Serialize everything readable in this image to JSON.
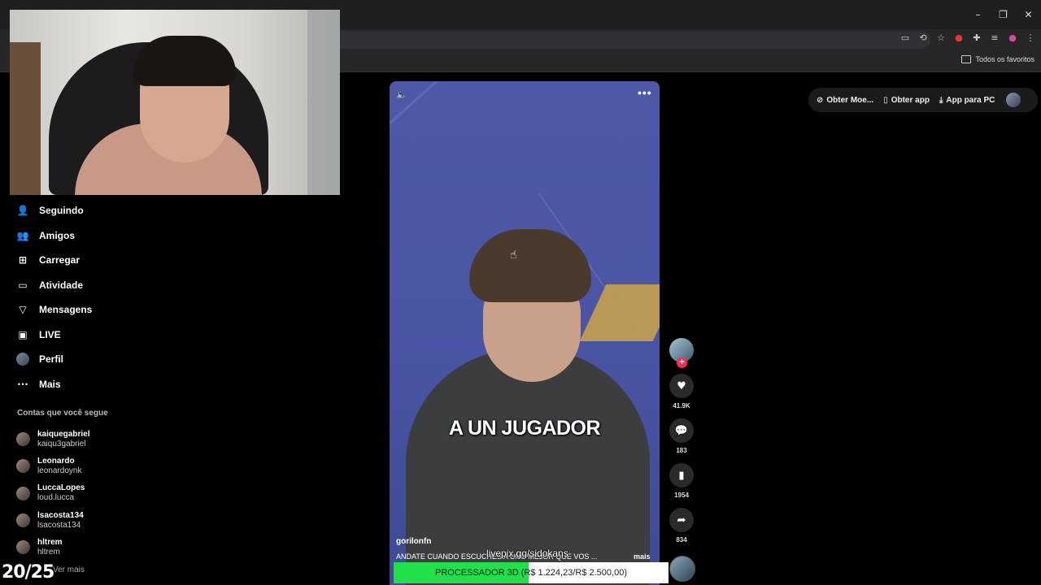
{
  "browser": {
    "window_controls": [
      "–",
      "❐",
      "✕"
    ],
    "bookmarks_all": "Todos os favoritos",
    "toolbar_icons": [
      "cast-icon",
      "translate-icon",
      "star-icon",
      "extension-red-icon",
      "puzzle-icon",
      "media-icon",
      "profile-icon",
      "menu-icon"
    ]
  },
  "sidebar": {
    "items": [
      {
        "label": "Seguindo",
        "icon": "following-icon",
        "glyph": "👤"
      },
      {
        "label": "Amigos",
        "icon": "friends-icon",
        "glyph": "👥"
      },
      {
        "label": "Carregar",
        "icon": "upload-icon",
        "glyph": "⊞"
      },
      {
        "label": "Atividade",
        "icon": "activity-icon",
        "glyph": "▭"
      },
      {
        "label": "Mensagens",
        "icon": "messages-icon",
        "glyph": "▽"
      },
      {
        "label": "LIVE",
        "icon": "live-icon",
        "glyph": "▣"
      },
      {
        "label": "Perfil",
        "icon": "profile-avatar",
        "glyph": ""
      },
      {
        "label": "Mais",
        "icon": "more-icon",
        "glyph": "···"
      }
    ],
    "following_heading": "Contas que você segue",
    "following": [
      {
        "name": "kaiquegabriel",
        "user": "kaiqu3gabriel"
      },
      {
        "name": "Leonardo",
        "user": "leonardoynk"
      },
      {
        "name": "LuccaLopes",
        "user": "loud.lucca"
      },
      {
        "name": "lsacosta134",
        "user": "lsacosta134"
      },
      {
        "name": "hltrem",
        "user": "hltrem"
      }
    ],
    "see_more": "Ver mais"
  },
  "overlay": {
    "score": "20/25",
    "livepix": "livepix.gg/sidokans"
  },
  "video": {
    "caption_overlay": "A UN JUGADOR",
    "author": "gorilonfn",
    "description": "ANDATE CUANDO ESCUCHES A UNO MEJOR QUE VOS ...",
    "more": "mais",
    "menu_dots": "•••"
  },
  "goal": {
    "label": "PROCESSADOR 3D (R$ 1.224,23/R$ 2.500,00)",
    "progress_fraction": 0.4897
  },
  "rail": {
    "follow_plus": "+",
    "likes": "41.9K",
    "comments": "183",
    "saves": "1954",
    "shares": "834"
  },
  "header": {
    "coins": "Obter Moe...",
    "get_app": "Obter app",
    "pc_app": "App para PC"
  }
}
